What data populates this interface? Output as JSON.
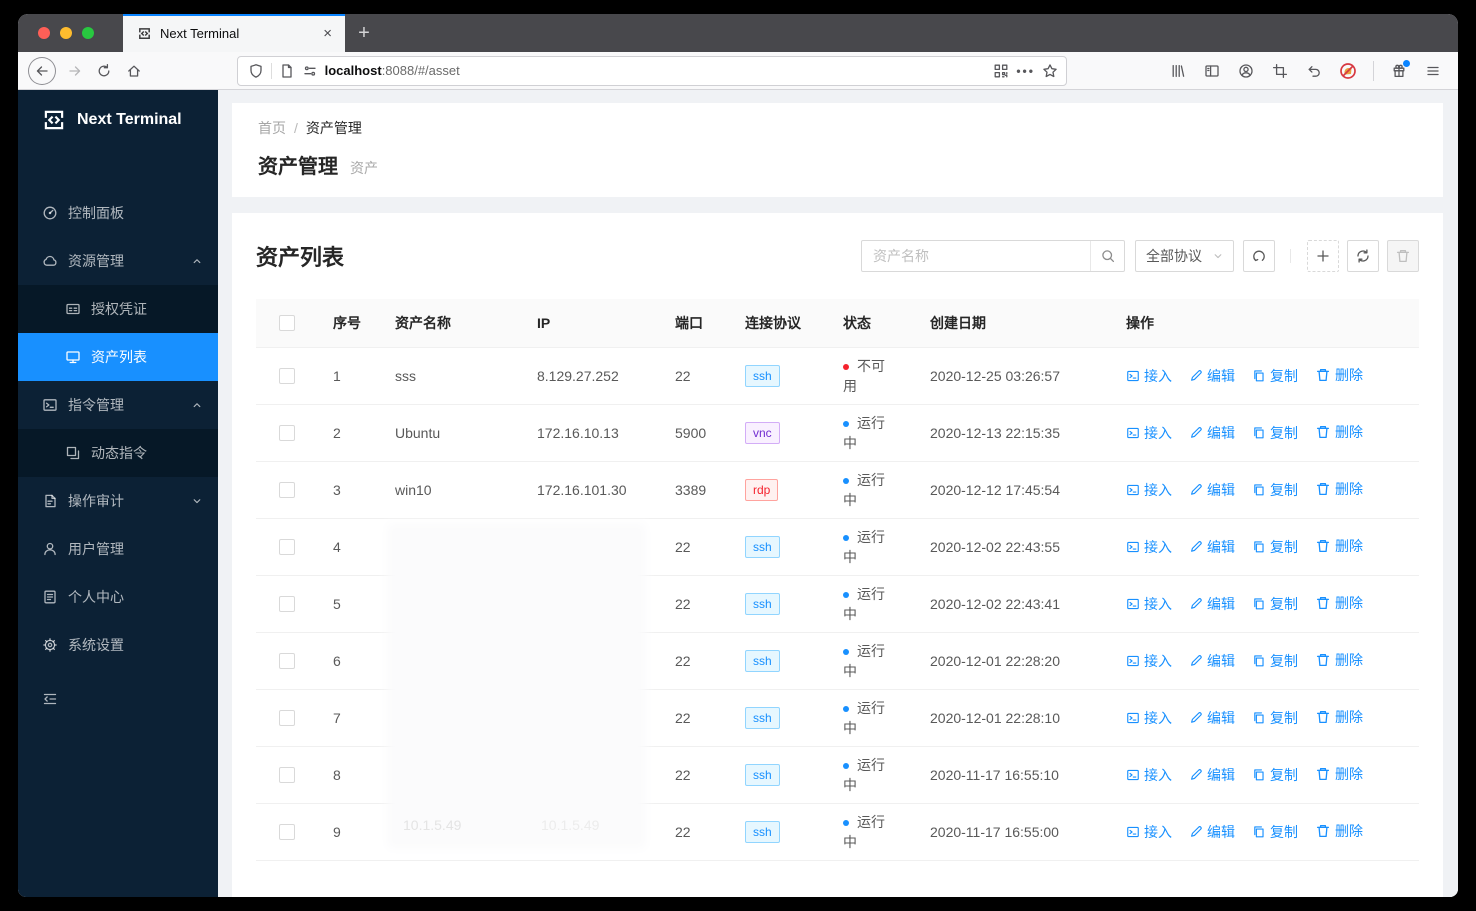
{
  "browser": {
    "tab_title": "Next Terminal",
    "url_host": "localhost",
    "url_path": ":8088/#/asset"
  },
  "breadcrumb": {
    "home": "首页",
    "separator": "/",
    "current": "资产管理"
  },
  "page": {
    "title": "资产管理",
    "subtitle": "资产"
  },
  "sidebar": {
    "logo_text": "Next Terminal",
    "items": [
      {
        "id": "dashboard",
        "label": "控制面板",
        "icon": "dashboard-icon",
        "level": 1
      },
      {
        "id": "resources",
        "label": "资源管理",
        "icon": "cloud-icon",
        "level": 1,
        "chevron": "up"
      },
      {
        "id": "credentials",
        "label": "授权凭证",
        "icon": "idcard-icon",
        "level": 2
      },
      {
        "id": "asset-list",
        "label": "资产列表",
        "icon": "desktop-icon",
        "level": 2,
        "selected": true
      },
      {
        "id": "commands",
        "label": "指令管理",
        "icon": "terminal-icon",
        "level": 1,
        "chevron": "up"
      },
      {
        "id": "dynamic-commands",
        "label": "动态指令",
        "icon": "block-icon",
        "level": 2
      },
      {
        "id": "audit",
        "label": "操作审计",
        "icon": "audit-icon",
        "level": 1,
        "chevron": "down"
      },
      {
        "id": "users",
        "label": "用户管理",
        "icon": "user-icon",
        "level": 1
      },
      {
        "id": "profile",
        "label": "个人中心",
        "icon": "profile-icon",
        "level": 1
      },
      {
        "id": "settings",
        "label": "系统设置",
        "icon": "gear-icon",
        "level": 1
      }
    ]
  },
  "card": {
    "title": "资产列表",
    "search_placeholder": "资产名称",
    "protocol_filter_label": "全部协议"
  },
  "table": {
    "columns": [
      "序号",
      "资产名称",
      "IP",
      "端口",
      "连接协议",
      "状态",
      "创建日期",
      "操作"
    ],
    "actions": [
      {
        "label": "接入",
        "icon": "connect-icon"
      },
      {
        "label": "编辑",
        "icon": "edit-icon"
      },
      {
        "label": "复制",
        "icon": "copy-icon"
      },
      {
        "label": "删除",
        "icon": "trash-icon"
      }
    ],
    "rows": [
      {
        "no": "1",
        "name": "sss",
        "ip": "8.129.27.252",
        "port": "22",
        "protocol": "ssh",
        "status": "不可用",
        "status_type": "error",
        "date": "2020-12-25 03:26:57",
        "redacted": false
      },
      {
        "no": "2",
        "name": "Ubuntu",
        "ip": "172.16.10.13",
        "port": "5900",
        "protocol": "vnc",
        "status": "运行中",
        "status_type": "running",
        "date": "2020-12-13 22:15:35",
        "redacted": false
      },
      {
        "no": "3",
        "name": "win10",
        "ip": "172.16.101.30",
        "port": "3389",
        "protocol": "rdp",
        "status": "运行中",
        "status_type": "running",
        "date": "2020-12-12 17:45:54",
        "redacted": false
      },
      {
        "no": "4",
        "name": "",
        "ip": "",
        "port": "22",
        "protocol": "ssh",
        "status": "运行中",
        "status_type": "running",
        "date": "2020-12-02 22:43:55",
        "redacted": true
      },
      {
        "no": "5",
        "name": "",
        "ip": "",
        "port": "22",
        "protocol": "ssh",
        "status": "运行中",
        "status_type": "running",
        "date": "2020-12-02 22:43:41",
        "redacted": true
      },
      {
        "no": "6",
        "name": "",
        "ip": "",
        "port": "22",
        "protocol": "ssh",
        "status": "运行中",
        "status_type": "running",
        "date": "2020-12-01 22:28:20",
        "redacted": true
      },
      {
        "no": "7",
        "name": "",
        "ip": "",
        "port": "22",
        "protocol": "ssh",
        "status": "运行中",
        "status_type": "running",
        "date": "2020-12-01 22:28:10",
        "redacted": true
      },
      {
        "no": "8",
        "name": "",
        "ip": "",
        "port": "22",
        "protocol": "ssh",
        "status": "运行中",
        "status_type": "running",
        "date": "2020-11-17 16:55:10",
        "redacted": true
      },
      {
        "no": "9",
        "name": "",
        "ip": "",
        "port": "22",
        "protocol": "ssh",
        "status": "运行中",
        "status_type": "running",
        "date": "2020-11-17 16:55:00",
        "redacted": true
      }
    ]
  },
  "redaction": {
    "faint_texts": [
      "10.1.5.49",
      "10.1.5.49"
    ]
  },
  "colors": {
    "accent": "#1890ff",
    "sidebar_bg": "#0c2135",
    "submenu_bg": "#061827",
    "selected_bg": "#1890ff",
    "status_running": "#1890ff",
    "status_unavailable": "#f5222d",
    "tag_ssh_text": "#1890ff",
    "tag_ssh_bg": "#e6f7ff",
    "tag_ssh_border": "#91d5ff",
    "tag_vnc_text": "#722ed1",
    "tag_vnc_bg": "#f9f0ff",
    "tag_vnc_border": "#d3adf7",
    "tag_rdp_text": "#f5222d",
    "tag_rdp_bg": "#fff1f0",
    "tag_rdp_border": "#ffa39e",
    "tab_accent": "#0a84ff"
  }
}
